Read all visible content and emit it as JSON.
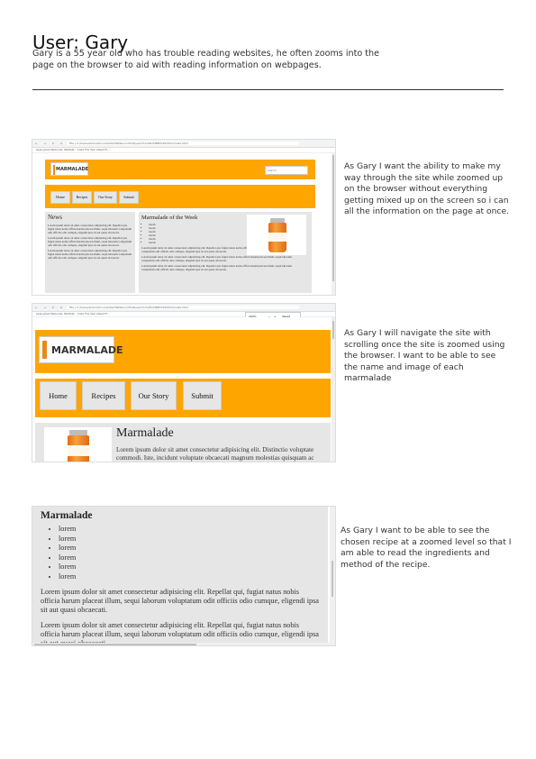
{
  "header": {
    "title": "User: Gary",
    "intro": "Gary is a 55 year old who has trouble reading websites, he often zooms into the page on the browser to aid with reading information on webpages."
  },
  "stories": [
    "As Gary I want the ability to make my way through the site while zoomed up on the browser without everything getting mixed up on the screen so i can all the information on the page at once.",
    "As Gary I will navigate the site with scrolling once the site is zoomed using the browser. I want to be able to see the name and image of each marmalade",
    "As Gary I want to be able to see the chosen recipe at a zoomed level so that I am able to read the ingredients and method of the recipe."
  ],
  "site": {
    "logo": "MARMALADE",
    "search_placeholder": "search",
    "nav": [
      "Home",
      "Recipes",
      "Our Story",
      "Submit"
    ],
    "news_heading": "News",
    "week_heading": "Marmalade of the Week",
    "list_item": "lorem",
    "lorem_short": "Lorem ipsum dolor sit amet consectetur adipisicing elit. Repellat qui, fugiat natus nobis officia harum placeat illum, sequi laborum voluptatum odit officiis odio cumque, eligendi ipsa sit aut quasi obcaecati.",
    "product_heading": "Marmalade",
    "product_text": "Lorem ipsum dolor sit amet consectetur adipisicing elit. Distinctio voluptate commodi. Iste, incidunt voluptate obcaecati magnum molestias quisquam ac",
    "recipe_heading": "Marmalade",
    "recipe_list": [
      "lorem",
      "lorem",
      "lorem",
      "lorem",
      "lorem",
      "lorem"
    ],
    "recipe_para": "Lorem ipsum dolor sit amet consectetur adipisicing elit. Repellat qui, fugiat natus nobis officia harum placeat illum, sequi laborum voluptatum odit officiis odio cumque, eligendi ipsa sit aut quasi obcaecati."
  },
  "browser": {
    "address": "File | C:/Users/anton/Documents/UNI/Second%20year/%%20UXINM%20/html/index.html",
    "bookmarks": "Apps  gmail  Welcome, Winfield...  Code  The Year Ahead Fr...",
    "zoom": "200%",
    "zoom_reset": "Reset"
  },
  "colors": {
    "accent": "#ffa500",
    "panel": "#e6e6e6"
  }
}
